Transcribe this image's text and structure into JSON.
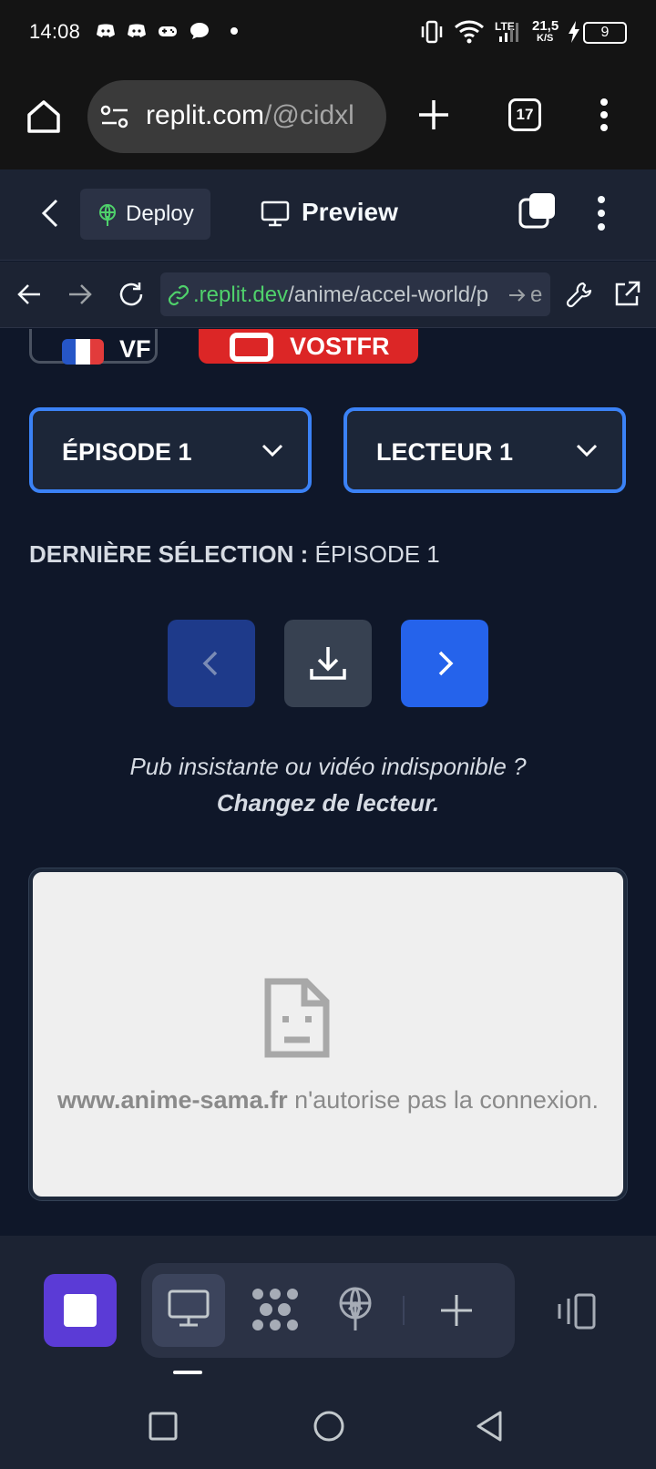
{
  "status_bar": {
    "time": "14:08",
    "network_type": "LTE",
    "speed": "21,5",
    "speed_unit": "K/S",
    "battery": "9"
  },
  "browser": {
    "url_main": "replit.com",
    "url_path": "/@cidxl",
    "tab_count": "17"
  },
  "replit_header": {
    "deploy_label": "Deploy",
    "preview_label": "Preview"
  },
  "webview": {
    "url_domain": ".replit.dev",
    "url_path": "/anime/accel-world/p",
    "url_suffix": "e"
  },
  "page": {
    "lang_label": "VF",
    "vost_label": "VOSTFR",
    "episode_select": "ÉPISODE 1",
    "player_select": "LECTEUR 1",
    "last_selection_label": "DERNIÈRE SÉLECTION :",
    "last_selection_value": "ÉPISODE 1",
    "notice_line1": "Pub insistante ou vidéo indisponible ?",
    "notice_line2": "Changez de lecteur.",
    "iframe_error_domain": "www.anime-sama.fr",
    "iframe_error_text": "n'autorise pas la connexion."
  },
  "colors": {
    "accent_blue": "#3b82f6",
    "next_button": "#2563eb",
    "prev_button": "#1e3a8a",
    "vost_red": "#dc2626",
    "run_button": "#5b3bd6"
  }
}
